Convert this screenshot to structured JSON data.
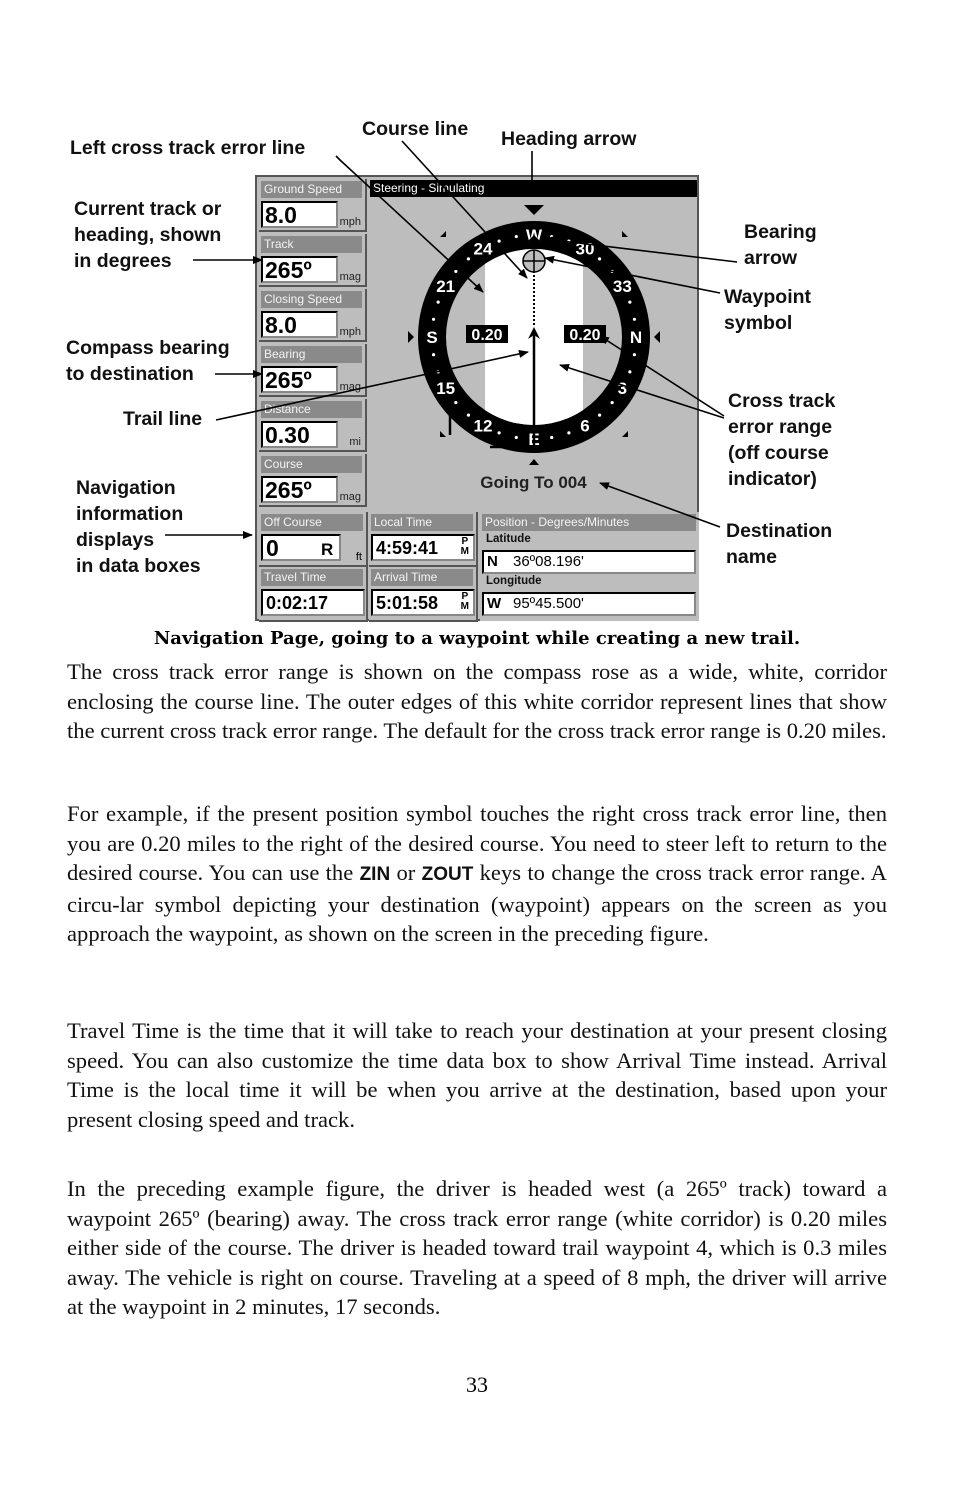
{
  "annotations": {
    "left_cross_track": "Left cross track error line",
    "course_line": "Course line",
    "heading_arrow": "Heading arrow",
    "current_track": "Current track or\nheading, shown\nin degrees",
    "bearing_arrow": "Bearing\narrow",
    "waypoint_symbol": "Waypoint\nsymbol",
    "compass_bearing": "Compass bearing\nto destination",
    "trail_line": "Trail line",
    "cross_track_range": "Cross track\nerror range\n(off course\nindicator)",
    "nav_info": "Navigation\ninformation\ndisplays\nin data boxes",
    "destination_name": "Destination\nname"
  },
  "screen": {
    "data_boxes": [
      {
        "label": "Ground Speed",
        "value": "8.0",
        "unit": "mph"
      },
      {
        "label": "Track",
        "value": "265º",
        "unit": "mag"
      },
      {
        "label": "Closing Speed",
        "value": "8.0",
        "unit": "mph"
      },
      {
        "label": "Bearing",
        "value": "265º",
        "unit": "mag"
      },
      {
        "label": "Distance",
        "value": "0.30",
        "unit": "mi"
      },
      {
        "label": "Course",
        "value": "265º",
        "unit": "mag"
      }
    ],
    "steering_title": "Steering - Simulating",
    "compass": {
      "labels": [
        "W",
        "30",
        "33",
        "N",
        "3",
        "6",
        "E",
        "12",
        "15",
        "S",
        "21",
        "24"
      ],
      "xte_left": "0.20",
      "xte_right": "0.20",
      "heading_deg": 265
    },
    "going_to": "Going To 004",
    "off_course": {
      "label": "Off Course",
      "value": "0",
      "side": "R",
      "unit": "ft"
    },
    "local_time": {
      "label": "Local Time",
      "value": "4:59:41",
      "ampm_top": "P",
      "ampm_bottom": "M"
    },
    "travel_time": {
      "label": "Travel Time",
      "value": "0:02:17"
    },
    "arrival_time": {
      "label": "Arrival Time",
      "value": "5:01:58",
      "ampm_top": "P",
      "ampm_bottom": "M"
    },
    "position": {
      "title": "Position - Degrees/Minutes",
      "lat_label": "Latitude",
      "lat_hemi": "N",
      "lat_value": "36º08.196'",
      "lon_label": "Longitude",
      "lon_hemi": "W",
      "lon_value": "95º45.500'"
    }
  },
  "caption": "Navigation Page, going to a waypoint while creating a new trail.",
  "paragraphs": {
    "p1": "The cross track error range is shown on the compass rose as a wide, white, corridor enclosing the course line. The outer edges of this white corridor represent lines that show the current cross track error range. The default for the cross track error range is 0.20 miles.",
    "p2a": "For example, if the present position symbol touches the right cross track error line, then you are 0.20 miles to the right of the desired course. You need to steer left to return to the desired course. You can use the ",
    "p2_key1": "ZIN",
    "p2b": " or ",
    "p2_key2": "ZOUT",
    "p2c": " keys to change the cross track error range. A circu-lar symbol depicting your destination (waypoint) appears on the screen as you approach the waypoint, as shown on the screen in the preceding figure.",
    "p3": "Travel Time is the time that it will take to reach your destination at your present closing speed. You can also customize the time data box to show Arrival Time instead. Arrival Time is the local time it will be when you arrive at the destination, based upon your present closing speed and track.",
    "p4": "In the preceding example figure, the driver is headed west (a 265º track) toward a waypoint 265º (bearing) away. The cross track error range (white corridor) is 0.20 miles either side of the course. The driver is headed toward trail waypoint 4, which is 0.3 miles away. The vehicle is right on course. Traveling at a speed of 8 mph, the driver will arrive at the waypoint in 2 minutes, 17 seconds."
  },
  "page_number": "33"
}
